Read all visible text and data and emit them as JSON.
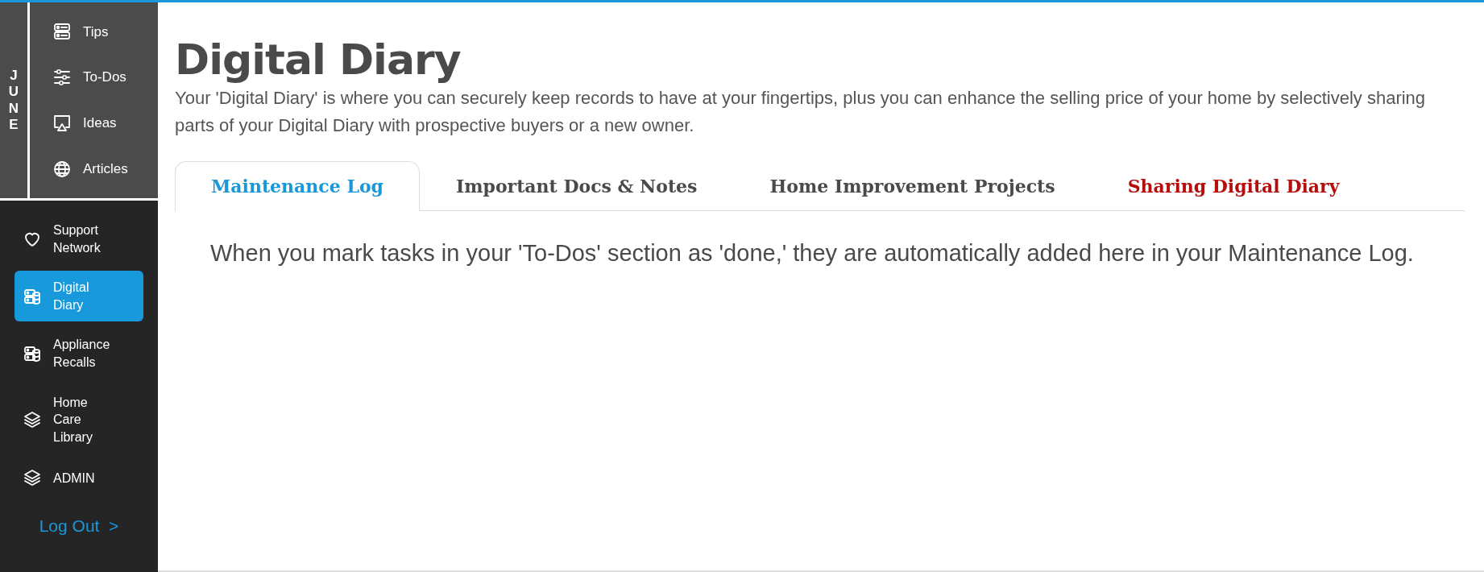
{
  "sidebar": {
    "month_letters": [
      "J",
      "U",
      "N",
      "E"
    ],
    "top_items": [
      {
        "label": "Tips",
        "kind": "cards"
      },
      {
        "label": "To-Dos",
        "kind": "sliders"
      },
      {
        "label": "Ideas",
        "kind": "screen"
      },
      {
        "label": "Articles",
        "kind": "globe"
      }
    ],
    "items": [
      {
        "label": "Support Network",
        "kind": "heart",
        "selected": false
      },
      {
        "label": "Digital Diary",
        "kind": "database",
        "selected": true
      },
      {
        "label": "Appliance Recalls",
        "kind": "database",
        "selected": false
      },
      {
        "label": "Home Care Library",
        "kind": "layers",
        "selected": false
      },
      {
        "label": "ADMIN",
        "kind": "layers",
        "selected": false
      }
    ],
    "logout": "Log Out  >"
  },
  "title": "Digital Diary",
  "description": "Your 'Digital Diary' is where you can securely keep records to have at your fingertips, plus you can enhance the selling price of your home by selectively sharing parts of your Digital Diary with prospective buyers or a new owner.",
  "tabs": [
    {
      "label": "Maintenance Log",
      "selected": true,
      "color": "#1a97d8"
    },
    {
      "label": "Important Docs & Notes",
      "selected": false,
      "color": "#4a4a4a"
    },
    {
      "label": "Home Improvement Projects",
      "selected": false,
      "color": "#4a4a4a"
    },
    {
      "label": "Sharing Digital Diary",
      "selected": false,
      "color": "#b50d0d"
    }
  ],
  "tab_content": "When you mark tasks in your 'To-Dos' section as 'done,' they are automatically added here in your Maintenance Log."
}
